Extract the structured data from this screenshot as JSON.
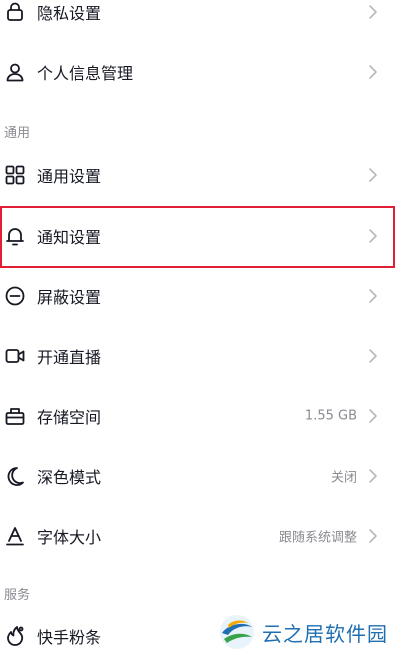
{
  "rows": [
    {
      "label": "隐私设置",
      "icon": "lock-icon"
    },
    {
      "label": "个人信息管理",
      "icon": "person-icon"
    },
    {
      "label": "通用设置",
      "icon": "grid-icon"
    },
    {
      "label": "通知设置",
      "icon": "bell-icon"
    },
    {
      "label": "屏蔽设置",
      "icon": "block-icon"
    },
    {
      "label": "开通直播",
      "icon": "video-camera-icon"
    },
    {
      "label": "存储空间",
      "icon": "storage-icon",
      "value": "1.55 GB"
    },
    {
      "label": "深色模式",
      "icon": "moon-icon",
      "value": "关闭"
    },
    {
      "label": "字体大小",
      "icon": "font-icon",
      "value": "跟随系统调整"
    },
    {
      "label": "快手粉条",
      "icon": "fan-boost-icon"
    }
  ],
  "sections": {
    "general": "通用",
    "services": "服务"
  },
  "highlight_color": "#e01e34",
  "watermark": {
    "text": "云之居软件园"
  }
}
